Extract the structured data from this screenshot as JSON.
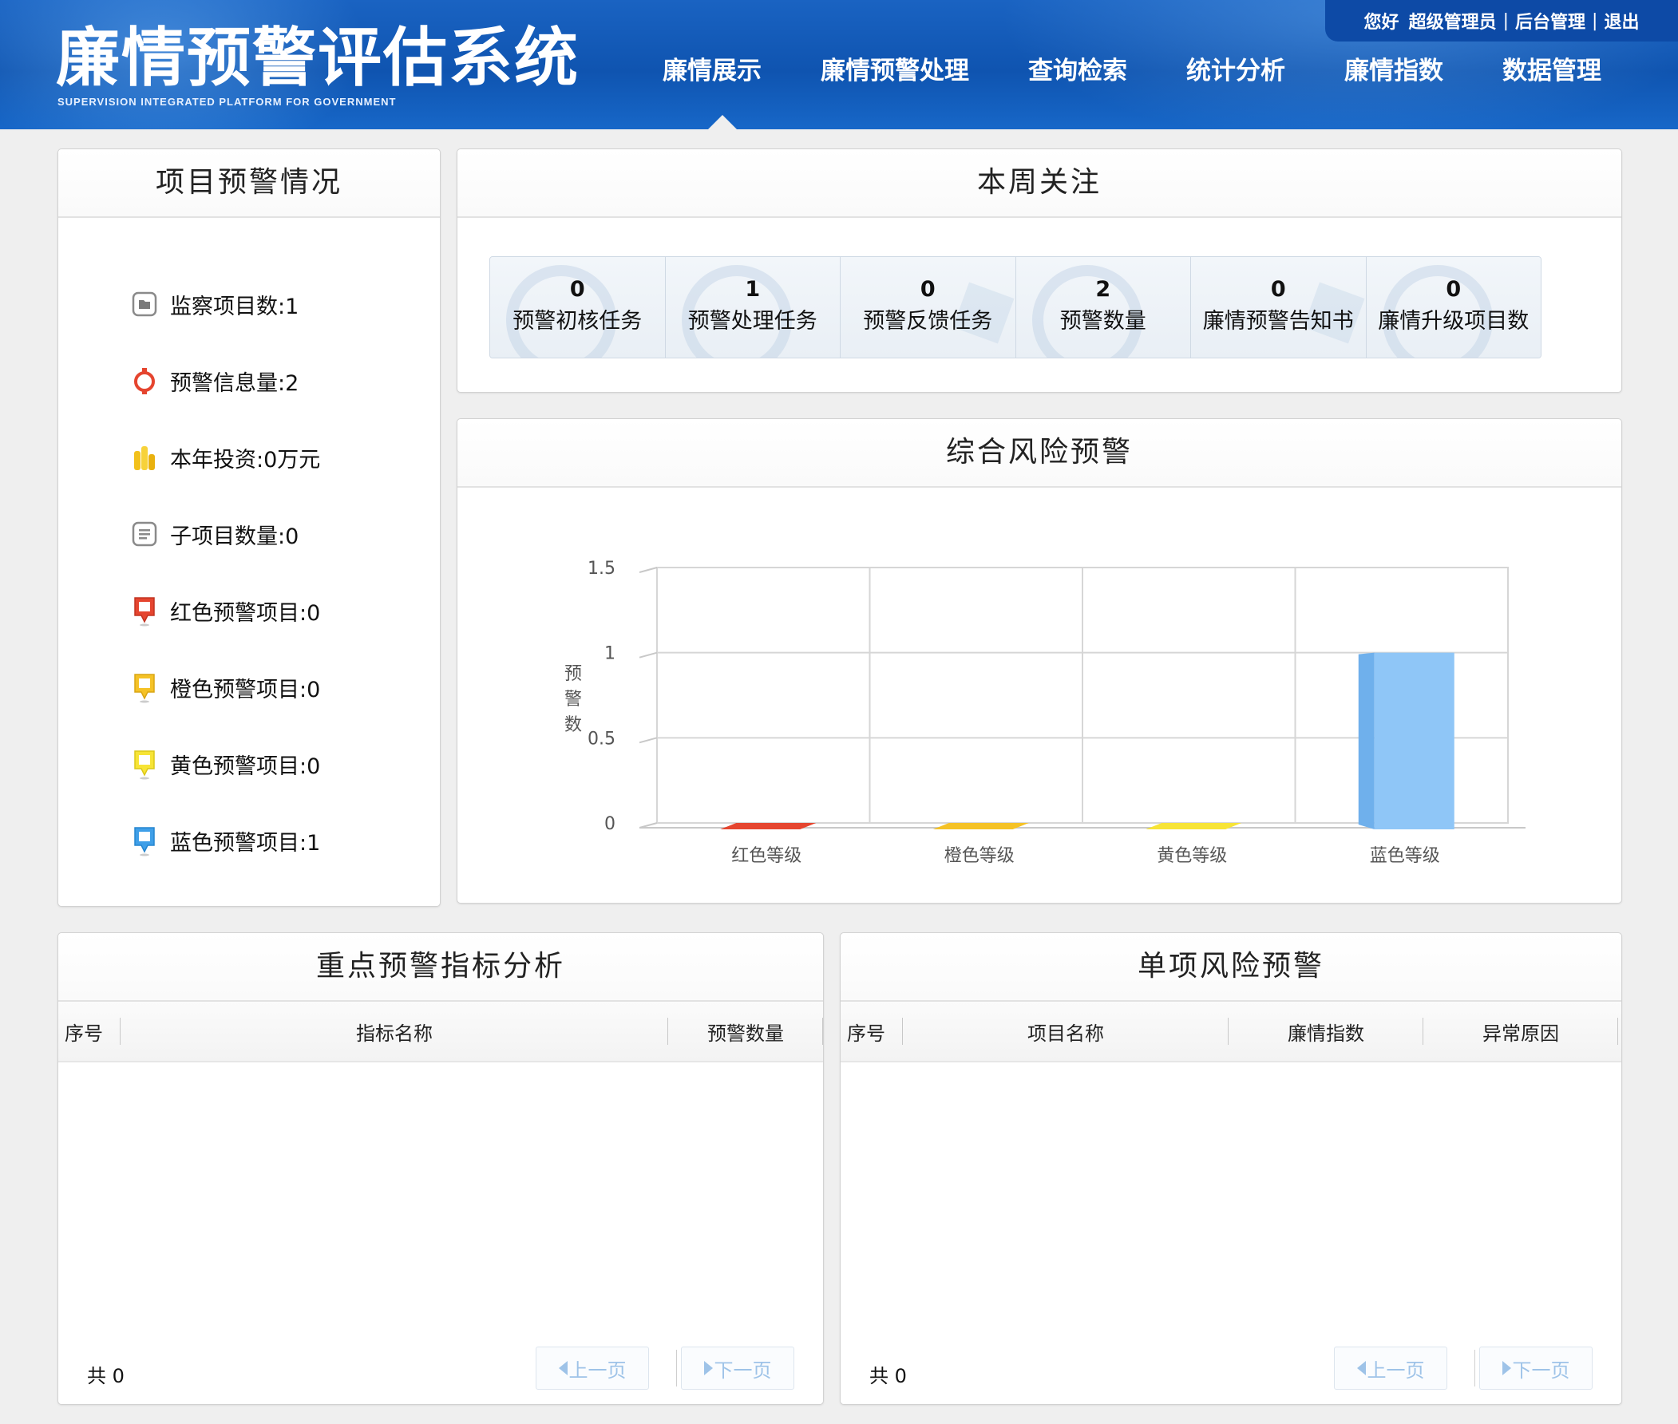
{
  "app": {
    "title": "廉情预警评估系统",
    "subtitle": "SUPERVISION INTEGRATED PLATFORM FOR GOVERNMENT"
  },
  "userbar": {
    "greeting": "您好",
    "user": "超级管理员",
    "admin_link": "后台管理",
    "logout": "退出",
    "sep": "|"
  },
  "nav": {
    "items": [
      "廉情展示",
      "廉情预警处理",
      "查询检索",
      "统计分析",
      "廉情指数",
      "数据管理"
    ],
    "active": "廉情展示"
  },
  "project_panel": {
    "title": "项目预警情况",
    "items": [
      {
        "label": "监察项目数:1",
        "icon": "folder-icon",
        "color": "#8a8a8a"
      },
      {
        "label": "预警信息量:2",
        "icon": "alarm-ring-icon",
        "color": "#e5452f"
      },
      {
        "label": "本年投资:0万元",
        "icon": "coins-icon",
        "color": "#f2c11c"
      },
      {
        "label": "子项目数量:0",
        "icon": "list-doc-icon",
        "color": "#8a8a8a"
      },
      {
        "label": "红色预警项目:0",
        "icon": "red-pin-icon",
        "color": "#e5452f"
      },
      {
        "label": "橙色预警项目:0",
        "icon": "orange-pin-icon",
        "color": "#f5c226"
      },
      {
        "label": "黄色预警项目:0",
        "icon": "yellow-pin-icon",
        "color": "#f7e436"
      },
      {
        "label": "蓝色预警项目:1",
        "icon": "blue-pin-icon",
        "color": "#3f9fe8"
      }
    ]
  },
  "weekly_panel": {
    "title": "本周关注",
    "cells": [
      {
        "value": "0",
        "label": "预警初核任务"
      },
      {
        "value": "1",
        "label": "预警处理任务"
      },
      {
        "value": "0",
        "label": "预警反馈任务"
      },
      {
        "value": "2",
        "label": "预警数量"
      },
      {
        "value": "0",
        "label": "廉情预警告知书"
      },
      {
        "value": "0",
        "label": "廉情升级项目数"
      }
    ]
  },
  "risk_panel": {
    "title": "综合风险预警"
  },
  "chart_data": {
    "type": "bar",
    "ylabel": "预警数",
    "xlabel": "",
    "categories": [
      "红色等级",
      "橙色等级",
      "黄色等级",
      "蓝色等级"
    ],
    "values": [
      0,
      0,
      0,
      1
    ],
    "colors": [
      "#e5452f",
      "#f5c226",
      "#f7e436",
      "#8fc6f7"
    ],
    "ylim": [
      0,
      1.5
    ],
    "yticks": [
      "0",
      "0.5",
      "1",
      "1.5"
    ],
    "grid": true
  },
  "indicator_panel": {
    "title": "重点预警指标分析",
    "columns": [
      "序号",
      "指标名称",
      "预警数量"
    ],
    "rows": [],
    "total": "共 0",
    "prev": "上一页",
    "next": "下一页"
  },
  "single_panel": {
    "title": "单项风险预警",
    "columns": [
      "序号",
      "项目名称",
      "廉情指数",
      "异常原因"
    ],
    "rows": [],
    "total": "共 0",
    "prev": "上一页",
    "next": "下一页"
  }
}
